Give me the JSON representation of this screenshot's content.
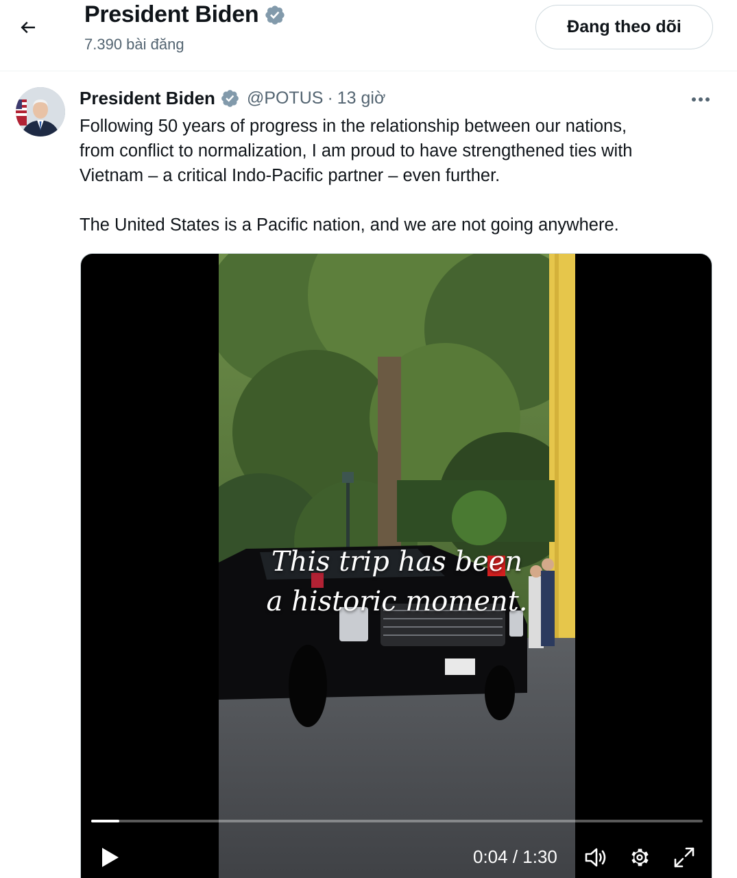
{
  "header": {
    "back_icon": "arrow-left-icon",
    "name": "President Biden",
    "posts_count": "7.390 bài đăng",
    "follow_label": "Đang theo dõi"
  },
  "tweet": {
    "author_name": "President Biden",
    "handle": "@POTUS",
    "separator": "·",
    "time": "13 giờ",
    "more_icon": "more-dots-icon",
    "text_lines": [
      "Following 50 years of progress in the relationship between our nations,",
      "from conflict to normalization, I am proud to have strengthened ties with",
      "Vietnam – a critical Indo-Pacific partner – even further.",
      "The United States is a Pacific nation, and we are not going anywhere."
    ]
  },
  "video": {
    "caption_line1": "This trip has been",
    "caption_line2": "a historic moment.",
    "time_display": "0:04 / 1:30",
    "progress_fraction": 0.046,
    "icons": [
      "play-icon",
      "volume-icon",
      "settings-gear-icon",
      "fullscreen-icon"
    ]
  },
  "colors": {
    "verified_badge": "#829aab",
    "text_primary": "#0f1419",
    "text_secondary": "#536471",
    "border": "#cfd9de"
  }
}
